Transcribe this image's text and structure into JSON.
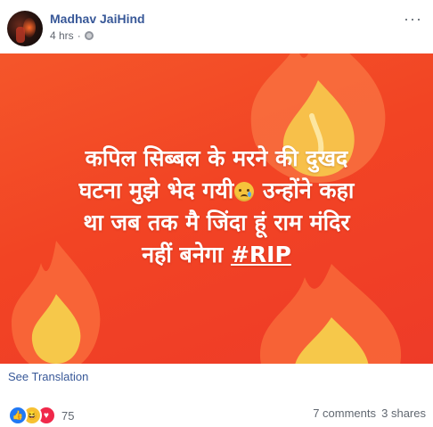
{
  "post": {
    "author": "Madhav JaiHind",
    "time": "4 hrs",
    "separator": "·",
    "more_label": "···"
  },
  "media": {
    "line1": "कपिल सिब्बल के मरने की दुखद",
    "line2a": "घटना मुझे भेद गयी",
    "line2b": " उन्होंने कहा",
    "line3": "था जब तक मै जिंदा हूं राम मंदिर",
    "line4a": "नहीं बनेगा ",
    "hashtag": "#RIP",
    "bg_color": "#f24424",
    "flame_outer": "#f8683a",
    "flame_inner": "#f6c84a"
  },
  "translation": {
    "label": "See Translation"
  },
  "footer": {
    "reaction_count": "75",
    "comments": "7 comments",
    "shares": "3 shares",
    "reaction_icons": [
      "like-icon",
      "haha-icon",
      "love-icon"
    ]
  }
}
